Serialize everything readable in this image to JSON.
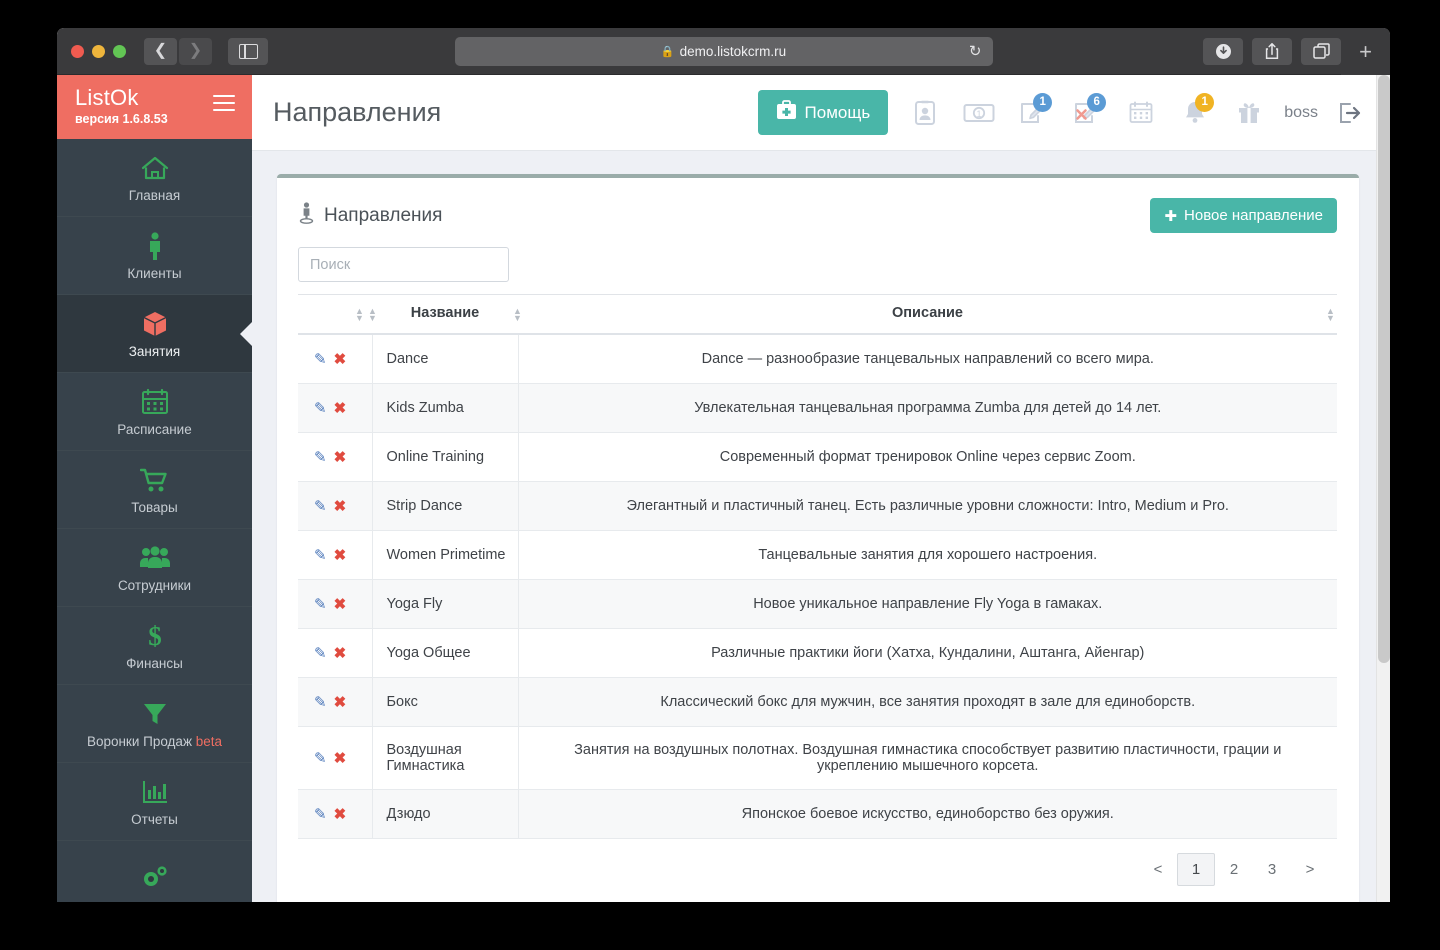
{
  "browser": {
    "url": "demo.listokcrm.ru",
    "lock_icon": "lock-icon",
    "reload_icon": "reload-icon",
    "back_icon": "back-chevron-icon",
    "forward_icon": "forward-chevron-icon",
    "sidebar_icon": "sidebar-toggle-icon",
    "download_icon": "download-icon",
    "share_icon": "share-icon",
    "tabs_icon": "tab-overview-icon",
    "newtab_label": "+"
  },
  "sidebar": {
    "brand": "ListOk",
    "version": "версия 1.6.8.53",
    "menu_icon": "hamburger-icon",
    "items": [
      {
        "label": "Главная",
        "icon": "home-icon",
        "active": false
      },
      {
        "label": "Клиенты",
        "icon": "person-icon",
        "active": false
      },
      {
        "label": "Занятия",
        "icon": "cube-icon",
        "active": true
      },
      {
        "label": "Расписание",
        "icon": "calendar-icon",
        "active": false
      },
      {
        "label": "Товары",
        "icon": "cart-icon",
        "active": false
      },
      {
        "label": "Сотрудники",
        "icon": "users-icon",
        "active": false
      },
      {
        "label": "Финансы",
        "icon": "dollar-icon",
        "active": false
      },
      {
        "label": "Воронки Продаж",
        "badge": "beta",
        "icon": "funnel-icon",
        "active": false
      },
      {
        "label": "Отчеты",
        "icon": "bar-chart-icon",
        "active": false
      },
      {
        "label": "",
        "icon": "gears-icon",
        "active": false
      }
    ]
  },
  "topbar": {
    "title": "Направления",
    "help_label": "Помощь",
    "help_icon": "first-aid-kit-icon",
    "help_color": "#49b6a8",
    "icons": [
      {
        "name": "id-card-icon",
        "badge": null,
        "badge_color": null
      },
      {
        "name": "banknote-icon",
        "badge": null,
        "badge_color": null
      },
      {
        "name": "edit-note-icon",
        "badge": "1",
        "badge_color": "#5b9bd5"
      },
      {
        "name": "cancel-note-icon",
        "badge": "6",
        "badge_color": "#5b9bd5"
      },
      {
        "name": "calendar-icon",
        "badge": null,
        "badge_color": null
      },
      {
        "name": "bell-icon",
        "badge": "1",
        "badge_color": "#f0b323"
      },
      {
        "name": "gift-icon",
        "badge": null,
        "badge_color": null
      }
    ],
    "username": "boss",
    "logout_icon": "logout-icon"
  },
  "card": {
    "title": "Направления",
    "title_icon": "direction-person-icon",
    "new_button": "Новое направление",
    "new_button_icon": "plus-icon",
    "search_placeholder": "Поиск",
    "search_value": "",
    "columns": [
      "",
      "Название",
      "Описание"
    ],
    "rows": [
      {
        "name": "Dance",
        "desc": "Dance — разнообразие танцевальных направлений со всего мира."
      },
      {
        "name": "Kids Zumba",
        "desc": "Увлекательная танцевальная программа Zumba для детей до 14 лет."
      },
      {
        "name": "Online Training",
        "desc": "Современный формат тренировок Online через сервис Zoom."
      },
      {
        "name": "Strip Dance",
        "desc": "Элегантный и пластичный танец. Есть различные уровни сложности: Intro, Medium и Pro."
      },
      {
        "name": "Women Primetime",
        "desc": "Танцевальные занятия для хорошего настроения."
      },
      {
        "name": "Yoga Fly",
        "desc": "Новое уникальное направление Fly Yoga в гамаках."
      },
      {
        "name": "Yoga Общее",
        "desc": "Различные практики йоги (Хатха, Кундалини, Аштанга, Айенгар)"
      },
      {
        "name": "Бокс",
        "desc": "Классический бокс для мужчин, все занятия проходят в зале для единоборств."
      },
      {
        "name": "Воздушная Гимнастика",
        "desc": "Занятия на воздушных полотнах. Воздушная гимнастика способствует развитию пластичности, грации и укреплению мышечного корсета."
      },
      {
        "name": "Дзюдо",
        "desc": "Японское боевое искусство, единоборство без оружия."
      }
    ],
    "row_edit_icon": "pencil-icon",
    "row_delete_icon": "x-mark-icon",
    "pagination": {
      "prev": "<",
      "pages": [
        "1",
        "2",
        "3"
      ],
      "active": "1",
      "next": ">"
    }
  }
}
